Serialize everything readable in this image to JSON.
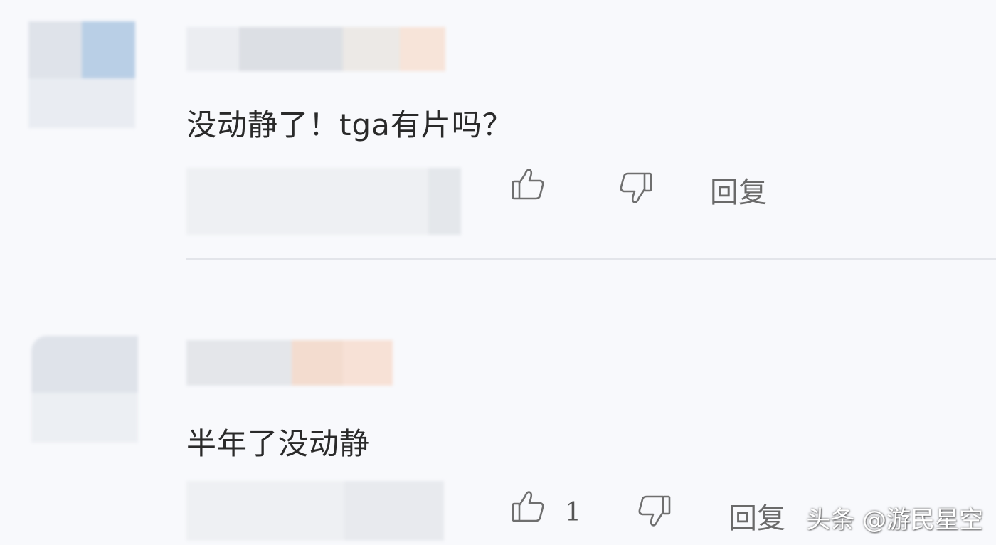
{
  "comments": [
    {
      "text": "没动静了！tga有片吗？",
      "actions": {
        "like_icon": "thumbs-up-icon",
        "dislike_icon": "thumbs-down-icon",
        "reply_label": "回复",
        "like_count": ""
      }
    },
    {
      "text": "半年了没动静",
      "actions": {
        "like_icon": "thumbs-up-icon",
        "dislike_icon": "thumbs-down-icon",
        "reply_label": "回复",
        "like_count": "1"
      }
    }
  ],
  "watermark": {
    "text": "头条 @游民星空"
  },
  "colors": {
    "background": "#f8f9fc",
    "text": "#2a2a2a",
    "action_gray": "#6a6a6a",
    "divider": "#e3e5ea"
  }
}
